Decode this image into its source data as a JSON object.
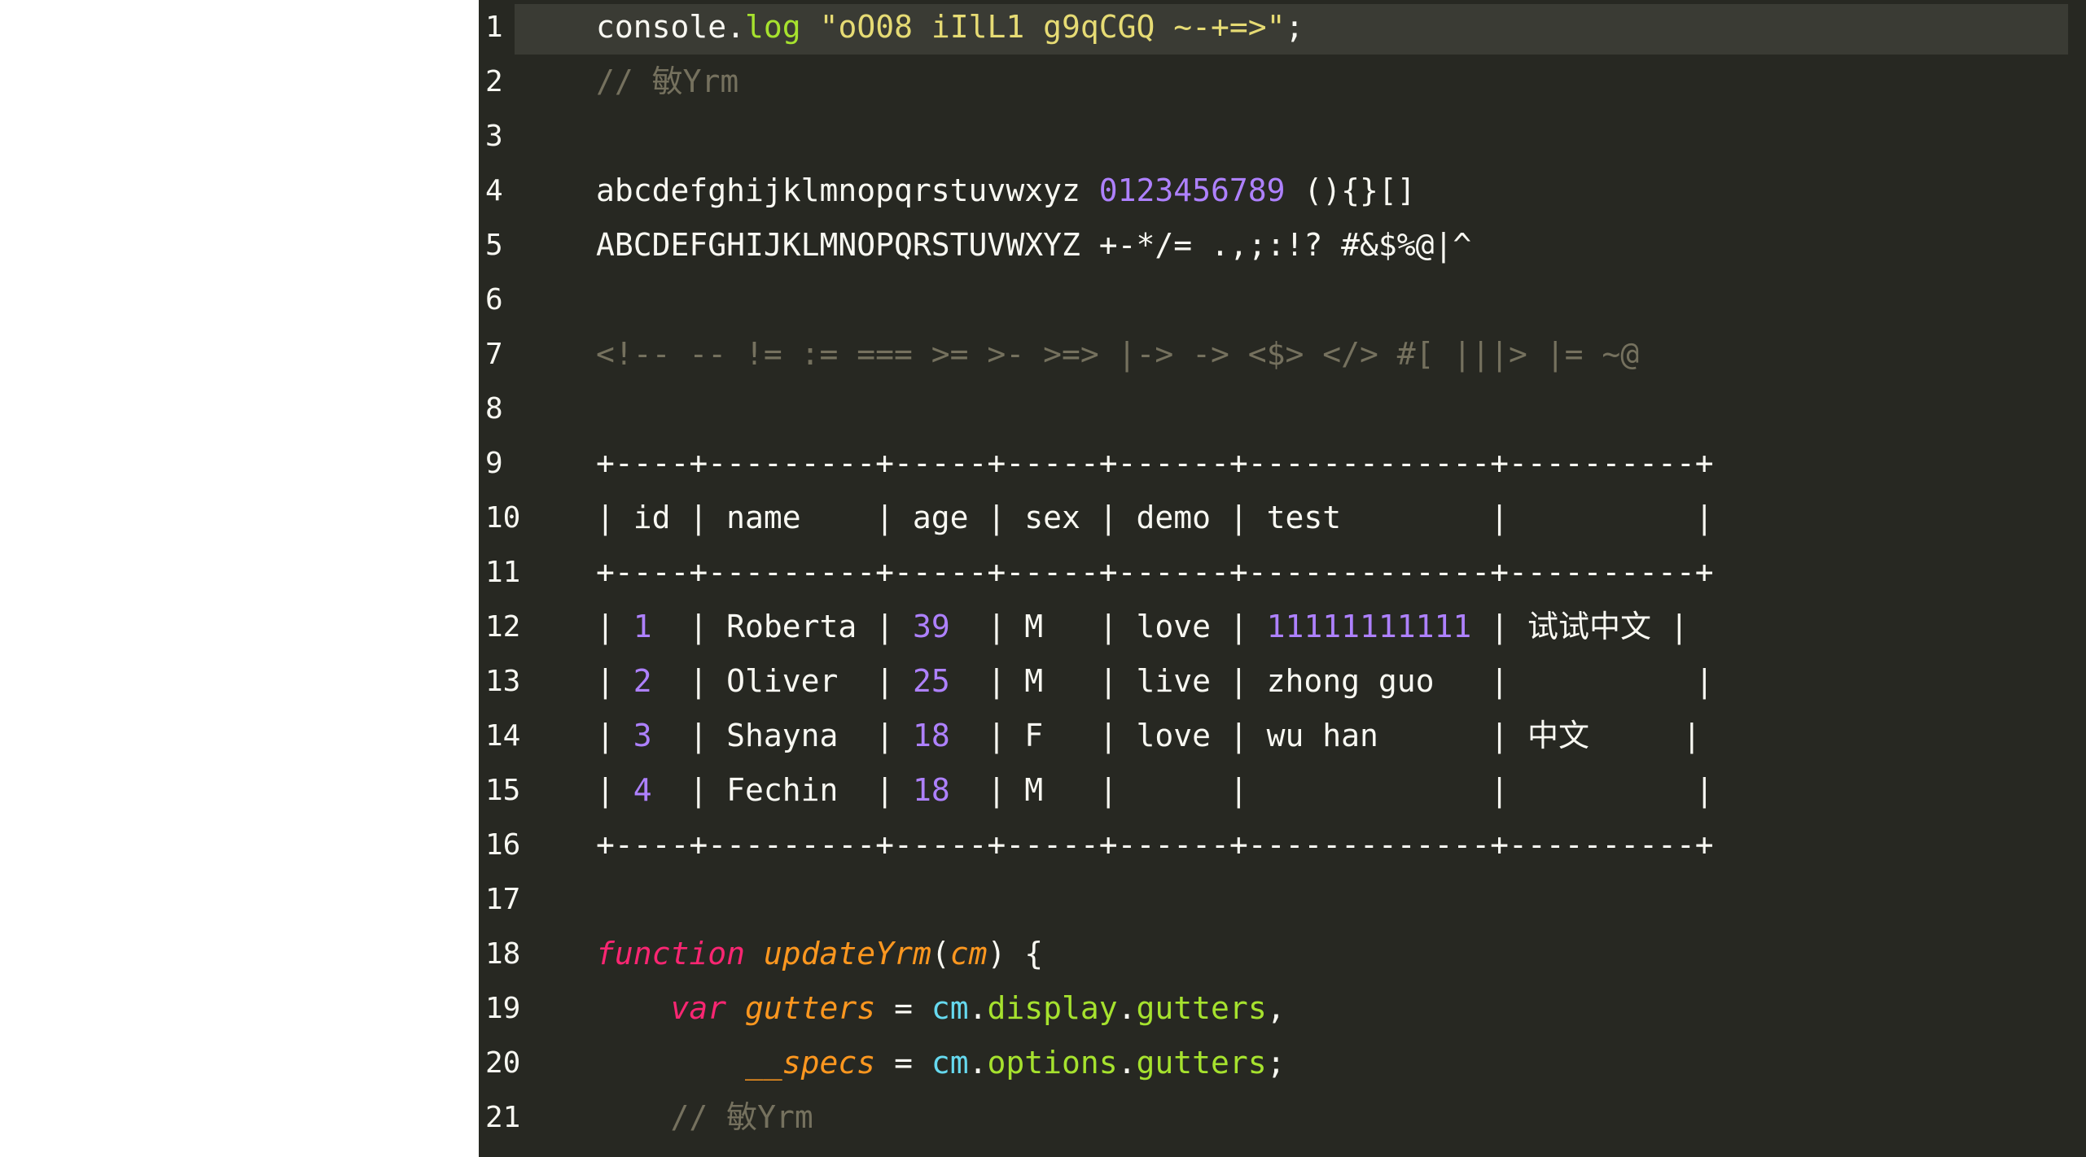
{
  "editor": {
    "theme_colors": {
      "background": "#272822",
      "active_line": "#3a3b34",
      "text": "#f8f8f2",
      "comment": "#75715e",
      "number": "#ae81ff",
      "string": "#e6db74",
      "keyword": "#f92672",
      "definition": "#fd971f",
      "builtin": "#66d9ef",
      "property": "#a6e22e"
    },
    "active_line": 1,
    "lines": [
      {
        "number": "1",
        "tokens": [
          {
            "text": "console.",
            "type": "default"
          },
          {
            "text": "log",
            "type": "method"
          },
          {
            "text": " ",
            "type": "default"
          },
          {
            "text": "\"oO08 iIlL1 g9qCGQ ~-+=>\"",
            "type": "string"
          },
          {
            "text": ";",
            "type": "default"
          }
        ]
      },
      {
        "number": "2",
        "tokens": [
          {
            "text": "// ",
            "type": "comment"
          },
          {
            "text": "敏Yrm",
            "type": "comment"
          }
        ]
      },
      {
        "number": "3",
        "tokens": []
      },
      {
        "number": "4",
        "tokens": [
          {
            "text": "abcdefghijklmnopqrstuvwxyz ",
            "type": "default"
          },
          {
            "text": "0123456789",
            "type": "number"
          },
          {
            "text": " (){}[]",
            "type": "default"
          }
        ]
      },
      {
        "number": "5",
        "tokens": [
          {
            "text": "ABCDEFGHIJKLMNOPQRSTUVWXYZ +-*/= .,;:!? #&$%@|^",
            "type": "default"
          }
        ]
      },
      {
        "number": "6",
        "tokens": []
      },
      {
        "number": "7",
        "tokens": [
          {
            "text": "<!-- -- != := === >= >- >=> |-> -> <$> </> #[ |||> |= ~@",
            "type": "comment"
          }
        ]
      },
      {
        "number": "8",
        "tokens": []
      },
      {
        "number": "9",
        "tokens": [
          {
            "text": "+----+---------+-----+-----+------+-------------+----------+",
            "type": "default"
          }
        ]
      },
      {
        "number": "10",
        "tokens": [
          {
            "text": "| id | name    | age | sex | demo | test        |          |",
            "type": "default"
          }
        ]
      },
      {
        "number": "11",
        "tokens": [
          {
            "text": "+----+---------+-----+-----+------+-------------+----------+",
            "type": "default"
          }
        ]
      },
      {
        "number": "12",
        "tokens": [
          {
            "text": "| ",
            "type": "default"
          },
          {
            "text": "1",
            "type": "number"
          },
          {
            "text": "  | Roberta | ",
            "type": "default"
          },
          {
            "text": "39",
            "type": "number"
          },
          {
            "text": "  | M   | love | ",
            "type": "default"
          },
          {
            "text": "11111111111",
            "type": "number"
          },
          {
            "text": " | ",
            "type": "default"
          },
          {
            "text": "试试中文",
            "type": "cjk"
          },
          {
            "text": " |",
            "type": "default"
          }
        ]
      },
      {
        "number": "13",
        "tokens": [
          {
            "text": "| ",
            "type": "default"
          },
          {
            "text": "2",
            "type": "number"
          },
          {
            "text": "  | Oliver  | ",
            "type": "default"
          },
          {
            "text": "25",
            "type": "number"
          },
          {
            "text": "  | M   | live | zhong guo   |          |",
            "type": "default"
          }
        ]
      },
      {
        "number": "14",
        "tokens": [
          {
            "text": "| ",
            "type": "default"
          },
          {
            "text": "3",
            "type": "number"
          },
          {
            "text": "  | Shayna  | ",
            "type": "default"
          },
          {
            "text": "18",
            "type": "number"
          },
          {
            "text": "  | F   | love | wu han      | ",
            "type": "default"
          },
          {
            "text": "中文",
            "type": "cjk"
          },
          {
            "text": "     |",
            "type": "default"
          }
        ]
      },
      {
        "number": "15",
        "tokens": [
          {
            "text": "| ",
            "type": "default"
          },
          {
            "text": "4",
            "type": "number"
          },
          {
            "text": "  | Fechin  | ",
            "type": "default"
          },
          {
            "text": "18",
            "type": "number"
          },
          {
            "text": "  | M   |      |             |          |",
            "type": "default"
          }
        ]
      },
      {
        "number": "16",
        "tokens": [
          {
            "text": "+----+---------+-----+-----+------+-------------+----------+",
            "type": "default"
          }
        ]
      },
      {
        "number": "17",
        "tokens": []
      },
      {
        "number": "18",
        "tokens": [
          {
            "text": "function",
            "type": "keyword"
          },
          {
            "text": " ",
            "type": "default"
          },
          {
            "text": "updateYrm",
            "type": "def"
          },
          {
            "text": "(",
            "type": "default"
          },
          {
            "text": "cm",
            "type": "var"
          },
          {
            "text": ") {",
            "type": "default"
          }
        ]
      },
      {
        "number": "19",
        "tokens": [
          {
            "text": "    ",
            "type": "default"
          },
          {
            "text": "var",
            "type": "keyword"
          },
          {
            "text": " ",
            "type": "default"
          },
          {
            "text": "gutters",
            "type": "var"
          },
          {
            "text": " = ",
            "type": "default"
          },
          {
            "text": "cm",
            "type": "builtin"
          },
          {
            "text": ".",
            "type": "default"
          },
          {
            "text": "display",
            "type": "prop"
          },
          {
            "text": ".",
            "type": "default"
          },
          {
            "text": "gutters",
            "type": "prop"
          },
          {
            "text": ",",
            "type": "default"
          }
        ]
      },
      {
        "number": "20",
        "tokens": [
          {
            "text": "        ",
            "type": "default"
          },
          {
            "text": "__specs",
            "type": "var"
          },
          {
            "text": " = ",
            "type": "default"
          },
          {
            "text": "cm",
            "type": "builtin"
          },
          {
            "text": ".",
            "type": "default"
          },
          {
            "text": "options",
            "type": "prop"
          },
          {
            "text": ".",
            "type": "default"
          },
          {
            "text": "gutters",
            "type": "prop"
          },
          {
            "text": ";",
            "type": "default"
          }
        ]
      },
      {
        "number": "21",
        "tokens": [
          {
            "text": "    ",
            "type": "default"
          },
          {
            "text": "// ",
            "type": "comment"
          },
          {
            "text": "敏Yrm",
            "type": "comment"
          }
        ]
      }
    ]
  }
}
